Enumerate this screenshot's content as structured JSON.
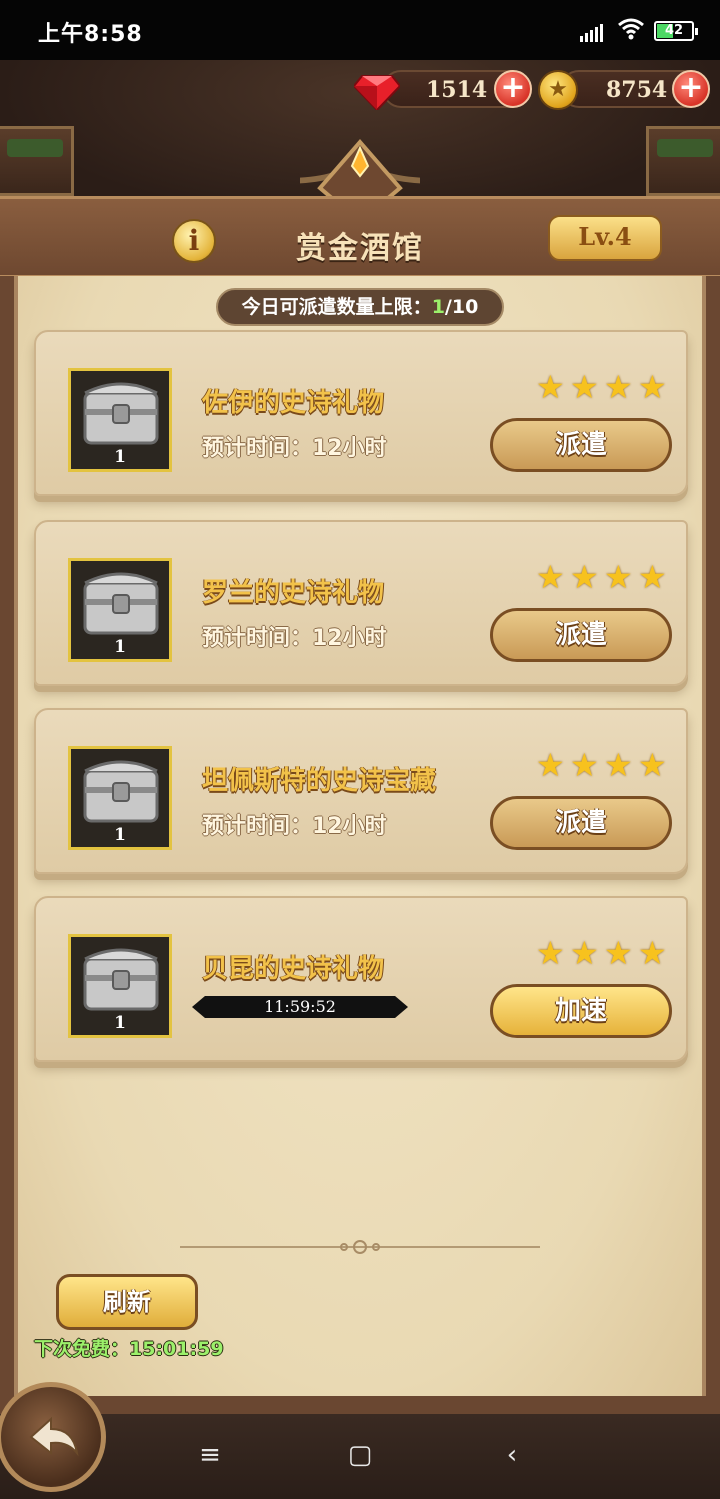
{
  "status_bar": {
    "time": "上午8:58",
    "battery": "42"
  },
  "currencies": {
    "gems": "1514",
    "coins": "8754"
  },
  "header": {
    "title": "赏金酒馆",
    "level": "Lv.4"
  },
  "dispatch_limit": {
    "label": "今日可派遣数量上限：",
    "current": "1",
    "max": "/10"
  },
  "quests": [
    {
      "name": "佐伊的史诗礼物",
      "time_label": "预计时间：12小时",
      "chest_qty": "1",
      "stars": 4,
      "action": "派遣"
    },
    {
      "name": "罗兰的史诗礼物",
      "time_label": "预计时间：12小时",
      "chest_qty": "1",
      "stars": 4,
      "action": "派遣"
    },
    {
      "name": "坦佩斯特的史诗宝藏",
      "time_label": "预计时间：12小时",
      "chest_qty": "1",
      "stars": 4,
      "action": "派遣"
    },
    {
      "name": "贝昆的史诗礼物",
      "timer": "11:59:52",
      "chest_qty": "1",
      "stars": 4,
      "action": "加速"
    }
  ],
  "refresh": {
    "label": "刷新",
    "next_free_label": "下次免费：",
    "next_free_time": "15:01:59"
  },
  "icons": {
    "gem": "gem-icon",
    "coin": "coin-icon",
    "plus": "plus-icon",
    "info": "info-icon",
    "star": "star-icon",
    "chest": "chest-icon",
    "back": "back-arrow-icon"
  },
  "colors": {
    "accent_gold": "#f2c24a",
    "highlight_green": "#9cf06b",
    "plus_red": "#d83428"
  }
}
